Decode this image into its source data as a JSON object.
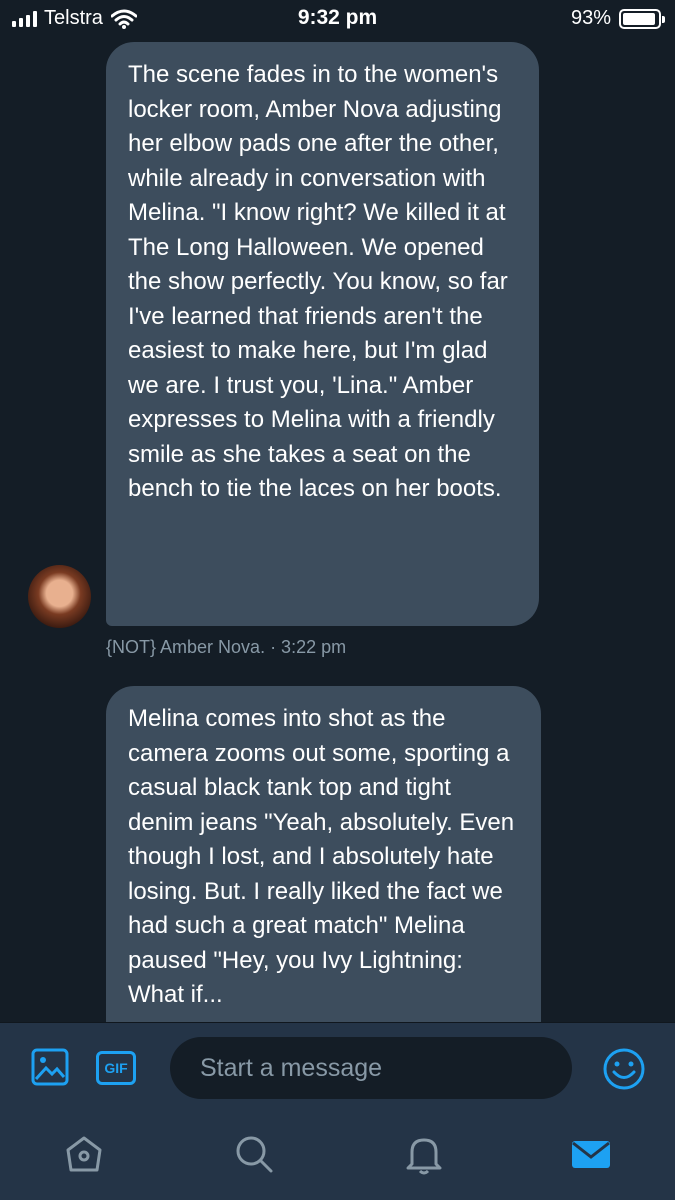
{
  "status_bar": {
    "carrier": "Telstra",
    "time": "9:32 pm",
    "battery_percent": "93%",
    "battery_level": 0.93
  },
  "messages": [
    {
      "text": "The scene fades in to the women's locker room, Amber Nova adjusting her elbow pads one after the other, while already in conversation with Melina. \"I know right? We killed it at The Long Halloween. We opened the show perfectly. You know, so far I've learned that friends aren't the easiest to make here, but I'm glad we are. I trust you, 'Lina.\" Amber expresses to Melina with a friendly smile as she takes a seat on the bench to tie the laces on her boots.",
      "meta": "{NOT} Amber Nova. · 3:22 pm"
    },
    {
      "text": "Melina comes into shot as the camera zooms out some, sporting a casual black tank top and tight denim jeans \"Yeah, absolutely. Even though I lost, and I absolutely hate losing. But. I really liked the fact we had such a great match\" Melina paused \"Hey, you Ivy Lightning: What if..."
    }
  ],
  "composer": {
    "placeholder": "Start a message",
    "gif_label": "GIF"
  },
  "icons": {
    "image": "image-icon",
    "gif": "gif-icon",
    "emoji": "emoji-icon",
    "home": "home-icon",
    "search": "search-icon",
    "notifications": "bell-icon",
    "messages": "envelope-icon"
  },
  "colors": {
    "background": "#141d26",
    "bubble": "#3d4d5d",
    "bar": "#243447",
    "accent": "#1da1f2",
    "muted": "#8899a6"
  }
}
